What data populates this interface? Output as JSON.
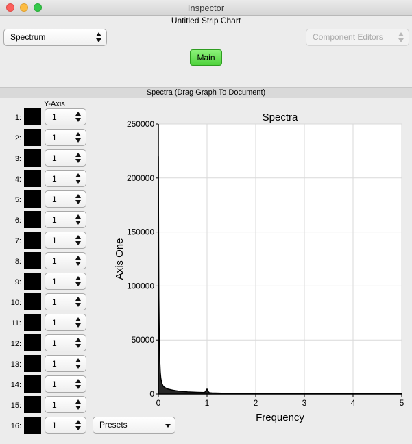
{
  "window": {
    "title": "Inspector",
    "subtitle": "Untitled Strip Chart"
  },
  "toolbar": {
    "view_select": "Spectrum",
    "component_editors": "Component Editors",
    "main_button": "Main"
  },
  "section": {
    "header": "Spectra (Drag Graph To Document)"
  },
  "channels": {
    "header": "Y-Axis",
    "rows": [
      {
        "label": "1:",
        "value": "1"
      },
      {
        "label": "2:",
        "value": "1"
      },
      {
        "label": "3:",
        "value": "1"
      },
      {
        "label": "4:",
        "value": "1"
      },
      {
        "label": "5:",
        "value": "1"
      },
      {
        "label": "6:",
        "value": "1"
      },
      {
        "label": "7:",
        "value": "1"
      },
      {
        "label": "8:",
        "value": "1"
      },
      {
        "label": "9:",
        "value": "1"
      },
      {
        "label": "10:",
        "value": "1"
      },
      {
        "label": "11:",
        "value": "1"
      },
      {
        "label": "12:",
        "value": "1"
      },
      {
        "label": "13:",
        "value": "1"
      },
      {
        "label": "14:",
        "value": "1"
      },
      {
        "label": "15:",
        "value": "1"
      },
      {
        "label": "16:",
        "value": "1"
      }
    ],
    "swatch_color": "#000000"
  },
  "presets": {
    "label": "Presets"
  },
  "chart_data": {
    "type": "line",
    "title": "Spectra",
    "xlabel": "Frequency",
    "ylabel": "Axis One",
    "xlim": [
      0,
      5
    ],
    "ylim": [
      0,
      250000
    ],
    "x_ticks": [
      0,
      1,
      2,
      3,
      4,
      5
    ],
    "x_tick_labels": [
      "0",
      "1",
      "2",
      "3",
      "4",
      "5"
    ],
    "y_ticks": [
      0,
      50000,
      100000,
      150000,
      200000,
      250000
    ],
    "y_tick_labels": [
      "0",
      "50000",
      "100000",
      "150000",
      "200000",
      "250000"
    ],
    "grid": true,
    "series": [
      {
        "color": "#000000",
        "x": [
          0,
          0.005,
          0.01,
          0.02,
          0.03,
          0.04,
          0.05,
          0.07,
          0.1,
          0.15,
          0.2,
          0.3,
          0.4,
          0.6,
          0.8,
          0.95,
          1.0,
          1.02,
          1.05,
          1.1,
          1.3,
          1.6,
          2.0,
          2.5,
          3.0,
          3.5,
          4.0,
          4.5,
          5.0
        ],
        "y": [
          220000,
          150000,
          90000,
          50000,
          30000,
          20000,
          15000,
          10000,
          7000,
          5500,
          4500,
          3500,
          2800,
          2000,
          1600,
          1400,
          4500,
          2500,
          1200,
          1000,
          800,
          600,
          500,
          400,
          350,
          300,
          250,
          200,
          150
        ]
      }
    ]
  }
}
